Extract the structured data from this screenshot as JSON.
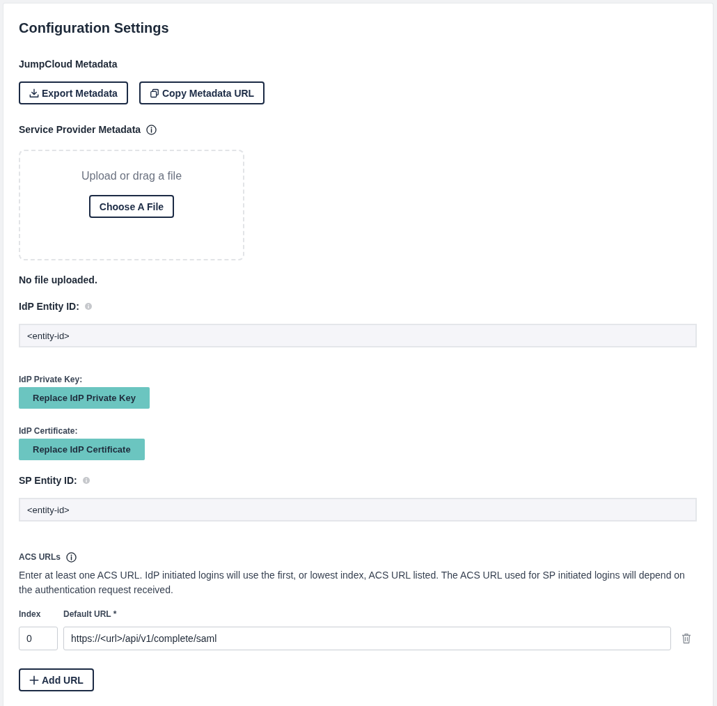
{
  "page": {
    "title": "Configuration Settings"
  },
  "jumpcloud_metadata": {
    "label": "JumpCloud Metadata",
    "buttons": [
      {
        "kind": "download",
        "label": "Export Metadata"
      },
      {
        "kind": "copy",
        "label": "Copy Metadata URL"
      }
    ]
  },
  "service_provider_metadata": {
    "label": "Service Provider Metadata",
    "dropzone": {
      "prompt": "Upload or drag a file",
      "button": "Choose A File"
    },
    "status": "No file uploaded."
  },
  "idp_entity_id": {
    "label": "IdP Entity ID:",
    "value": "<entity-id>"
  },
  "idp_private_key": {
    "label": "IdP Private Key:",
    "button": "Replace IdP Private Key"
  },
  "idp_certificate": {
    "label": "IdP Certificate:",
    "button": "Replace IdP Certificate"
  },
  "sp_entity_id": {
    "label": "SP Entity ID:",
    "value": "<entity-id>"
  },
  "acs_urls": {
    "label": "ACS URLs",
    "description": "Enter at least one ACS URL. IdP initiated logins will use the first, or lowest index, ACS URL listed. The ACS URL used for SP initiated logins will depend on the authentication request received.",
    "columns": [
      "Index",
      "Default URL *"
    ],
    "rows": [
      {
        "index": "0",
        "url": "https://<url>/api/v1/complete/saml"
      }
    ],
    "add_button": "Add URL"
  }
}
